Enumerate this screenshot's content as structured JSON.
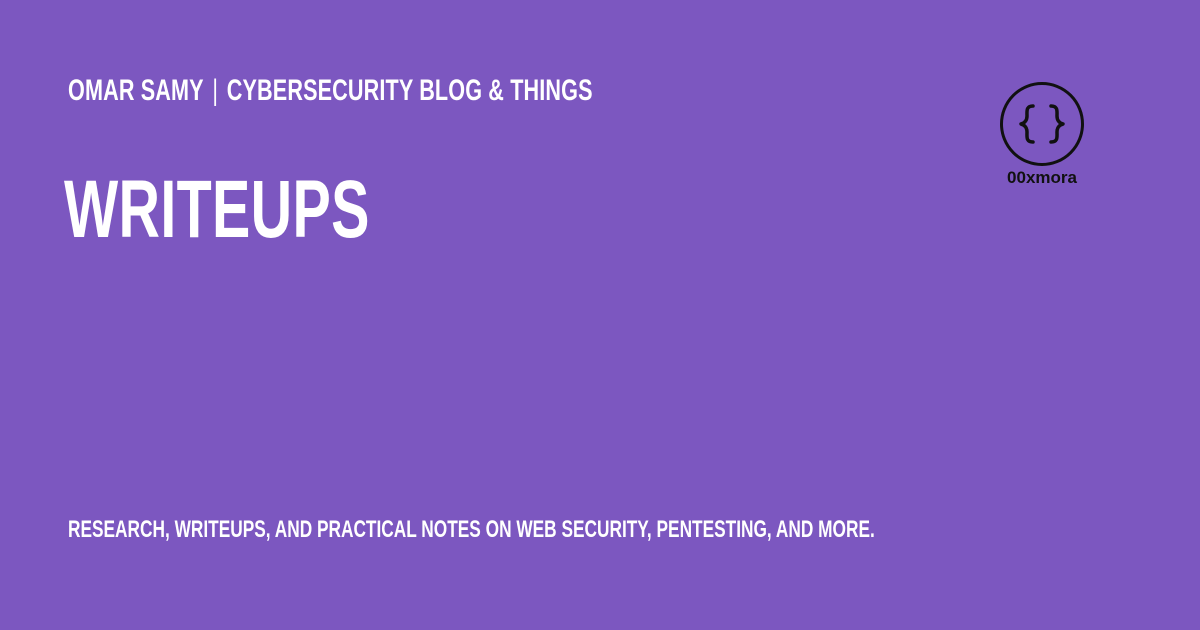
{
  "header": {
    "author": "OMAR SAMY",
    "separator": "|",
    "site": "CYBERSECURITY BLOG & THINGS"
  },
  "headline": "WRITEUPS",
  "tagline": "RESEARCH, WRITEUPS, AND PRACTICAL NOTES ON WEB SECURITY, PENTESTING, AND MORE.",
  "logo": {
    "name": "00xmora",
    "icon": "curly-braces-icon"
  },
  "colors": {
    "background": "#7c57c0",
    "text": "#ffffff",
    "logo": "#111111"
  }
}
